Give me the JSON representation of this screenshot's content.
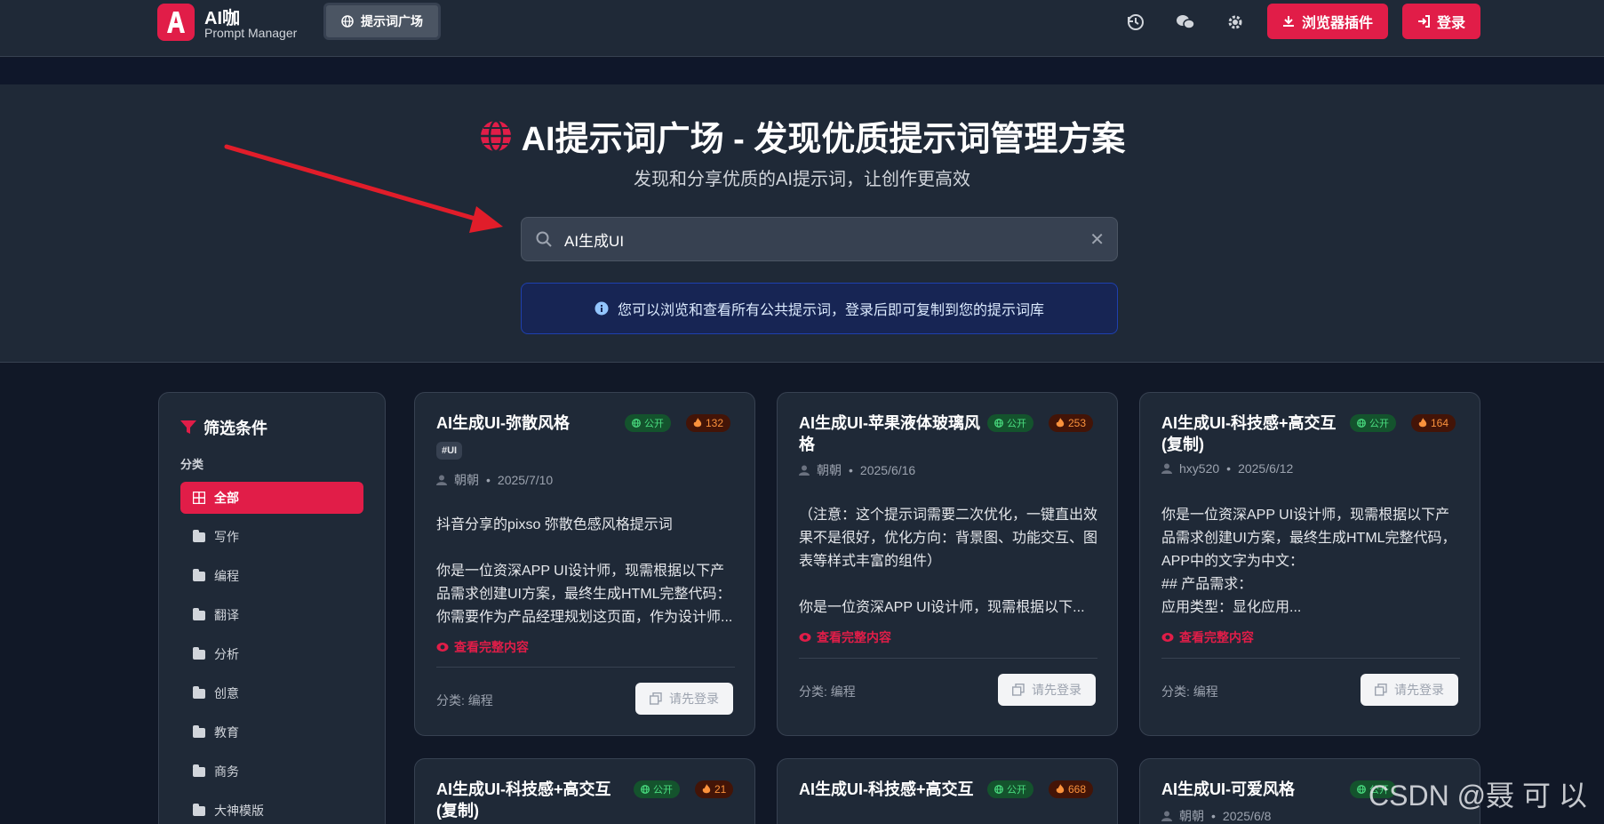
{
  "header": {
    "app_name": "AI咖",
    "app_sub": "Prompt Manager",
    "nav_label": "提示词广场",
    "plugin_label": "浏览器插件",
    "login_label": "登录"
  },
  "hero": {
    "title": "AI提示词广场 - 发现优质提示词管理方案",
    "subtitle": "发现和分享优质的AI提示词，让创作更高效",
    "search_value": "AI生成UI",
    "notice": "您可以浏览和查看所有公共提示词，登录后即可复制到您的提示词库"
  },
  "sidebar": {
    "title": "筛选条件",
    "section_label": "分类",
    "items": [
      "全部",
      "写作",
      "编程",
      "翻译",
      "分析",
      "创意",
      "教育",
      "商务",
      "大神模版"
    ]
  },
  "cards": [
    {
      "title": "AI生成UI-弥散风格",
      "public": "公开",
      "hot": "132",
      "tag": "#UI",
      "author": "朝朝",
      "date": "2025/7/10",
      "body": "抖音分享的pixso 弥散色感风格提示词\n\n你是一位资深APP UI设计师，现需根据以下产品需求创建UI方案，最终生成HTML完整代码：你需要作为产品经理规划这页面，作为设计师...",
      "view": "查看完整内容",
      "category": "分类: 编程",
      "btn": "请先登录"
    },
    {
      "title": "AI生成UI-苹果液体玻璃风格",
      "public": "公开",
      "hot": "253",
      "author": "朝朝",
      "date": "2025/6/16",
      "body": "（注意：这个提示词需要二次优化，一键直出效果不是很好，优化方向：背景图、功能交互、图表等样式丰富的组件）\n\n你是一位资深APP UI设计师，现需根据以下...",
      "view": "查看完整内容",
      "category": "分类: 编程",
      "btn": "请先登录"
    },
    {
      "title": "AI生成UI-科技感+高交互 (复制)",
      "public": "公开",
      "hot": "164",
      "author": "hxy520",
      "date": "2025/6/12",
      "body": "你是一位资深APP UI设计师，现需根据以下产品需求创建UI方案，最终生成HTML完整代码，APP中的文字为中文：\n## 产品需求：\n应用类型：显化应用...",
      "view": "查看完整内容",
      "category": "分类: 编程",
      "btn": "请先登录"
    },
    {
      "title": "AI生成UI-科技感+高交互 (复制)",
      "public": "公开",
      "hot": "21"
    },
    {
      "title": "AI生成UI-科技感+高交互",
      "public": "公开",
      "hot": "668"
    },
    {
      "title": "AI生成UI-可爱风格",
      "public": "公开",
      "author": "朝朝",
      "date": "2025/6/8"
    }
  ],
  "watermark": "CSDN @聂 可 以",
  "colors": {
    "accent": "#e11d48",
    "bg": "#111827",
    "panel": "#1f2937"
  }
}
